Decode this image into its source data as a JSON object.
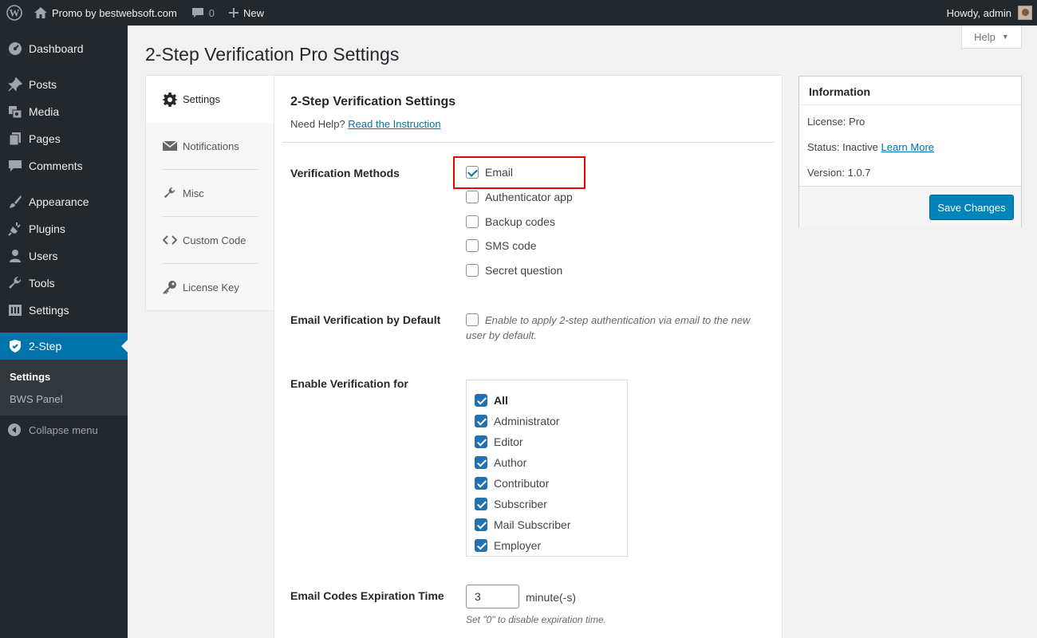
{
  "adminbar": {
    "site_name": "Promo by bestwebsoft.com",
    "comments_count": "0",
    "new_label": "New",
    "greeting": "Howdy, admin"
  },
  "sidebar": {
    "items": [
      {
        "label": "Dashboard",
        "icon": "dashboard-icon"
      },
      {
        "label": "Posts",
        "icon": "pin-icon"
      },
      {
        "label": "Media",
        "icon": "media-icon"
      },
      {
        "label": "Pages",
        "icon": "pages-icon"
      },
      {
        "label": "Comments",
        "icon": "comment-icon"
      },
      {
        "label": "Appearance",
        "icon": "brush-icon"
      },
      {
        "label": "Plugins",
        "icon": "plugin-icon"
      },
      {
        "label": "Users",
        "icon": "user-icon"
      },
      {
        "label": "Tools",
        "icon": "wrench-icon"
      },
      {
        "label": "Settings",
        "icon": "settings-icon"
      },
      {
        "label": "2-Step",
        "icon": "shield-icon"
      }
    ],
    "submenu": [
      "Settings",
      "BWS Panel"
    ],
    "collapse_label": "Collapse menu"
  },
  "help_label": "Help",
  "page_title": "2-Step Verification Pro Settings",
  "tabs": [
    {
      "label": "Settings",
      "icon": "gear-icon"
    },
    {
      "label": "Notifications",
      "icon": "envelope-icon"
    },
    {
      "label": "Misc",
      "icon": "wrench-icon"
    },
    {
      "label": "Custom Code",
      "icon": "code-icon"
    },
    {
      "label": "License Key",
      "icon": "key-icon"
    }
  ],
  "form": {
    "heading": "2-Step Verification Settings",
    "need_help": "Need Help?",
    "instruction_link": "Read the Instruction",
    "verification_methods": {
      "label": "Verification Methods",
      "options": [
        {
          "label": "Email",
          "checked": true
        },
        {
          "label": "Authenticator app",
          "checked": false
        },
        {
          "label": "Backup codes",
          "checked": false
        },
        {
          "label": "SMS code",
          "checked": false
        },
        {
          "label": "Secret question",
          "checked": false
        }
      ]
    },
    "email_default": {
      "label": "Email Verification by Default",
      "description_line1": "Enable to apply 2-step authentication via email to the new",
      "description_line2": "user by default.",
      "checked": false
    },
    "enable_for": {
      "label": "Enable Verification for",
      "roles": [
        {
          "label": "All",
          "checked": true
        },
        {
          "label": "Administrator",
          "checked": true
        },
        {
          "label": "Editor",
          "checked": true
        },
        {
          "label": "Author",
          "checked": true
        },
        {
          "label": "Contributor",
          "checked": true
        },
        {
          "label": "Subscriber",
          "checked": true
        },
        {
          "label": "Mail Subscriber",
          "checked": true
        },
        {
          "label": "Employer",
          "checked": true
        }
      ]
    },
    "expiration": {
      "label": "Email Codes Expiration Time",
      "value": "3",
      "unit": "minute(-s)",
      "hint": "Set \"0\" to disable expiration time."
    }
  },
  "info": {
    "title": "Information",
    "license_label": "License:",
    "license_value": "Pro",
    "status_label": "Status:",
    "status_value": "Inactive",
    "learn_more": "Learn More",
    "version_label": "Version:",
    "version_value": "1.0.7",
    "save_label": "Save Changes"
  },
  "colors": {
    "admin_dark": "#23282d",
    "accent_blue": "#0073aa",
    "button_blue": "#0085ba",
    "highlight_red": "#ee0000"
  }
}
